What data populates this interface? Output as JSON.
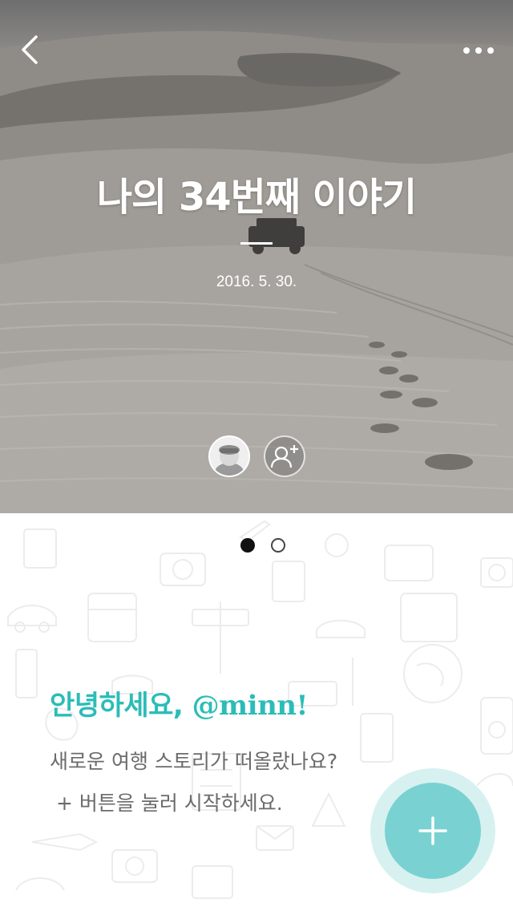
{
  "header": {
    "back_icon": "chevron-left-icon",
    "more_icon": "more-horizontal-icon"
  },
  "story": {
    "title": "나의 34번째 이야기",
    "date": "2016. 5. 30."
  },
  "members": {
    "avatar_icon": "user-avatar",
    "add_icon": "add-member-icon"
  },
  "pager": {
    "current_page": 1,
    "total_pages": 2
  },
  "welcome": {
    "greeting": "안녕하세요,",
    "handle": "@minn!",
    "line1": "새로운 여행 스토리가 떠올랐나요?",
    "line2": "+ 버튼을 눌러 시작하세요."
  },
  "fab": {
    "icon": "plus-icon"
  },
  "colors": {
    "accent": "#2cbcb8",
    "fab": "#79d2d1",
    "body_text": "#6b6b6b"
  }
}
